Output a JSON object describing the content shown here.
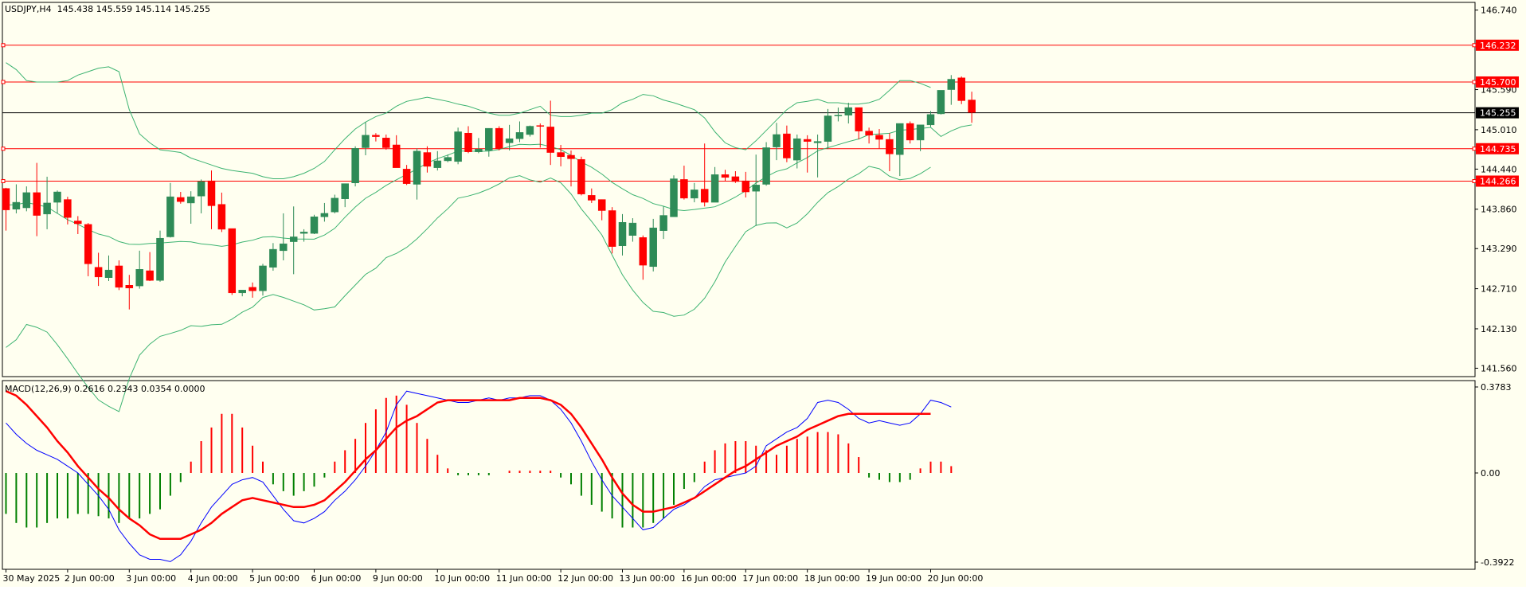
{
  "header": {
    "symbol_tf": "USDJPY,H4",
    "ohlc": "145.438 145.559 145.114 145.255"
  },
  "macd_header": "MACD(12,26,9) 0.2616 0.2343 0.0354 0.0000",
  "colors": {
    "background": "#fffff0",
    "bull_candle": "#2e8b57",
    "bear_candle": "#ff0000",
    "bands": "#3cb371",
    "level_line": "#ff0000",
    "price_line": "#000000",
    "macd_line": "#0000ff",
    "signal_line": "#ff0000",
    "hist_pos": "#ff0000",
    "hist_neg": "#008000"
  },
  "chart_data": [
    {
      "type": "candlestick",
      "instrument": "USDJPY",
      "timeframe": "H4",
      "y_ticks": [
        "146.740",
        "145.590",
        "145.010",
        "144.440",
        "143.860",
        "143.290",
        "142.710",
        "142.130",
        "141.560"
      ],
      "ylim": [
        141.45,
        146.84
      ],
      "x_labels": [
        "30 May 2025",
        "2 Jun 00:00",
        "3 Jun 00:00",
        "4 Jun 00:00",
        "5 Jun 00:00",
        "6 Jun 00:00",
        "9 Jun 00:00",
        "10 Jun 00:00",
        "11 Jun 00:00",
        "12 Jun 00:00",
        "13 Jun 00:00",
        "16 Jun 00:00",
        "17 Jun 00:00",
        "18 Jun 00:00",
        "19 Jun 00:00",
        "20 Jun 00:00"
      ],
      "x_label_bar_index": [
        0,
        6,
        12,
        18,
        24,
        30,
        36,
        42,
        48,
        54,
        60,
        66,
        72,
        78,
        84,
        90
      ],
      "horizontal_levels": [
        {
          "label": "146.232",
          "value": 146.232,
          "color": "#ff0000"
        },
        {
          "label": "145.700",
          "value": 145.7,
          "color": "#ff0000"
        },
        {
          "label": "145.255",
          "value": 145.255,
          "color": "#000000"
        },
        {
          "label": "144.735",
          "value": 144.735,
          "color": "#ff0000"
        },
        {
          "label": "144.266",
          "value": 144.266,
          "color": "#ff0000"
        }
      ],
      "candles": [
        [
          144.16,
          144.17,
          143.55,
          143.85
        ],
        [
          143.86,
          144.22,
          143.8,
          143.96
        ],
        [
          143.88,
          144.19,
          143.83,
          144.1
        ],
        [
          144.1,
          144.53,
          143.47,
          143.77
        ],
        [
          143.79,
          144.33,
          143.57,
          143.95
        ],
        [
          143.96,
          144.13,
          143.8,
          144.11
        ],
        [
          144.0,
          144.04,
          143.64,
          143.74
        ],
        [
          143.69,
          143.76,
          143.5,
          143.65
        ],
        [
          143.64,
          143.66,
          142.89,
          143.07
        ],
        [
          143.02,
          143.23,
          142.75,
          142.88
        ],
        [
          142.87,
          143.19,
          142.82,
          142.98
        ],
        [
          143.04,
          143.12,
          142.69,
          142.73
        ],
        [
          142.76,
          142.91,
          142.41,
          142.72
        ],
        [
          142.75,
          143.26,
          142.71,
          142.99
        ],
        [
          142.97,
          143.24,
          142.82,
          142.83
        ],
        [
          142.83,
          143.55,
          142.81,
          143.44
        ],
        [
          143.46,
          144.24,
          143.45,
          144.04
        ],
        [
          144.03,
          144.11,
          143.94,
          143.97
        ],
        [
          143.95,
          144.12,
          143.65,
          144.04
        ],
        [
          144.05,
          144.29,
          143.8,
          144.26
        ],
        [
          144.27,
          144.42,
          143.57,
          143.91
        ],
        [
          143.93,
          144.1,
          143.53,
          143.57
        ],
        [
          143.58,
          143.58,
          142.62,
          142.65
        ],
        [
          142.65,
          142.69,
          142.6,
          142.69
        ],
        [
          142.73,
          142.8,
          142.58,
          142.68
        ],
        [
          142.68,
          143.07,
          142.61,
          143.04
        ],
        [
          143.02,
          143.37,
          142.97,
          143.28
        ],
        [
          143.26,
          143.8,
          143.12,
          143.36
        ],
        [
          143.39,
          143.9,
          142.92,
          143.46
        ],
        [
          143.51,
          143.57,
          143.39,
          143.53
        ],
        [
          143.51,
          143.78,
          143.5,
          143.75
        ],
        [
          143.75,
          143.95,
          143.68,
          143.8
        ],
        [
          143.82,
          144.07,
          143.8,
          144.02
        ],
        [
          144.01,
          144.23,
          143.89,
          144.23
        ],
        [
          144.24,
          144.77,
          144.19,
          144.74
        ],
        [
          144.75,
          145.12,
          144.64,
          144.93
        ],
        [
          144.93,
          144.96,
          144.84,
          144.91
        ],
        [
          144.89,
          144.94,
          144.72,
          144.75
        ],
        [
          144.79,
          144.93,
          144.47,
          144.46
        ],
        [
          144.44,
          144.5,
          144.21,
          144.23
        ],
        [
          144.22,
          144.74,
          144.0,
          144.7
        ],
        [
          144.68,
          144.77,
          144.39,
          144.48
        ],
        [
          144.46,
          144.7,
          144.42,
          144.56
        ],
        [
          144.56,
          144.65,
          144.54,
          144.61
        ],
        [
          144.55,
          145.04,
          144.51,
          144.98
        ],
        [
          144.96,
          145.06,
          144.67,
          144.69
        ],
        [
          144.69,
          144.89,
          144.67,
          144.73
        ],
        [
          144.71,
          145.03,
          144.62,
          145.03
        ],
        [
          145.03,
          145.06,
          144.71,
          144.74
        ],
        [
          144.82,
          145.08,
          144.71,
          144.88
        ],
        [
          144.88,
          145.13,
          144.83,
          144.97
        ],
        [
          144.94,
          145.07,
          144.91,
          145.06
        ],
        [
          145.07,
          145.1,
          144.75,
          145.06
        ],
        [
          145.05,
          145.43,
          144.5,
          144.68
        ],
        [
          144.68,
          144.79,
          144.48,
          144.62
        ],
        [
          144.64,
          144.71,
          144.19,
          144.59
        ],
        [
          144.58,
          144.62,
          144.06,
          144.08
        ],
        [
          144.06,
          144.16,
          143.95,
          143.99
        ],
        [
          144.0,
          144.0,
          143.7,
          143.84
        ],
        [
          143.84,
          143.89,
          143.22,
          143.32
        ],
        [
          143.33,
          143.79,
          143.19,
          143.67
        ],
        [
          143.48,
          143.73,
          143.39,
          143.66
        ],
        [
          143.45,
          143.48,
          142.84,
          143.05
        ],
        [
          143.03,
          143.72,
          142.96,
          143.59
        ],
        [
          143.55,
          143.9,
          143.43,
          143.77
        ],
        [
          143.75,
          144.35,
          143.75,
          144.3
        ],
        [
          144.29,
          144.49,
          144.0,
          144.02
        ],
        [
          144.02,
          144.24,
          143.96,
          144.14
        ],
        [
          144.15,
          144.81,
          143.9,
          143.96
        ],
        [
          143.96,
          144.47,
          143.99,
          144.36
        ],
        [
          144.36,
          144.43,
          144.26,
          144.32
        ],
        [
          144.33,
          144.41,
          144.24,
          144.26
        ],
        [
          144.27,
          144.4,
          144.03,
          144.11
        ],
        [
          144.12,
          144.65,
          143.62,
          144.21
        ],
        [
          144.22,
          144.83,
          144.2,
          144.75
        ],
        [
          144.76,
          145.11,
          144.57,
          144.94
        ],
        [
          144.95,
          145.07,
          144.54,
          144.6
        ],
        [
          144.57,
          144.94,
          144.45,
          144.88
        ],
        [
          144.87,
          144.93,
          144.39,
          144.84
        ],
        [
          144.82,
          144.94,
          144.32,
          144.84
        ],
        [
          144.84,
          145.31,
          144.73,
          145.21
        ],
        [
          145.21,
          145.33,
          145.13,
          145.22
        ],
        [
          145.22,
          145.4,
          145.1,
          145.33
        ],
        [
          145.33,
          145.33,
          144.87,
          144.99
        ],
        [
          144.99,
          145.04,
          144.81,
          144.93
        ],
        [
          144.93,
          145.02,
          144.74,
          144.87
        ],
        [
          144.87,
          144.96,
          144.41,
          144.66
        ],
        [
          144.65,
          145.1,
          144.34,
          145.1
        ],
        [
          145.1,
          145.13,
          144.81,
          144.86
        ],
        [
          144.86,
          145.0,
          144.7,
          145.08
        ],
        [
          145.08,
          145.28,
          145.05,
          145.23
        ],
        [
          145.24,
          145.53,
          145.23,
          145.58
        ],
        [
          145.59,
          145.8,
          145.37,
          145.74
        ],
        [
          145.76,
          145.78,
          145.38,
          145.43
        ],
        [
          145.44,
          145.56,
          145.11,
          145.26
        ]
      ],
      "bollinger": {
        "upper": [
          145.98,
          145.88,
          145.72,
          145.7,
          145.7,
          145.7,
          145.72,
          145.8,
          145.85,
          145.9,
          145.92,
          145.85,
          145.3,
          144.95,
          144.82,
          144.72,
          144.7,
          144.68,
          144.6,
          144.55,
          144.5,
          144.45,
          144.42,
          144.4,
          144.38,
          144.33,
          144.3,
          144.3,
          144.33,
          144.38,
          144.45,
          144.55,
          144.72,
          144.88,
          145.02,
          145.12,
          145.2,
          145.25,
          145.35,
          145.42,
          145.45,
          145.48,
          145.45,
          145.42,
          145.38,
          145.35,
          145.3,
          145.25,
          145.22,
          145.22,
          145.25,
          145.3,
          145.35,
          145.22,
          145.2,
          145.2,
          145.22,
          145.25,
          145.25,
          145.3,
          145.4,
          145.45,
          145.52,
          145.5,
          145.44,
          145.4,
          145.35,
          145.3,
          145.18,
          144.98,
          144.82,
          144.75,
          144.72,
          144.85,
          145.0,
          145.15,
          145.3,
          145.4,
          145.42,
          145.45,
          145.4,
          145.4,
          145.38,
          145.38,
          145.4,
          145.45,
          145.58,
          145.72,
          145.72,
          145.68,
          145.62
        ]
      },
      "macd": {
        "ylim": [
          -0.3922,
          0.3783
        ],
        "y_ticks": [
          "0.3783",
          "0.00",
          "-0.3922"
        ],
        "macd": [
          0.22,
          0.17,
          0.13,
          0.1,
          0.08,
          0.06,
          0.03,
          0.0,
          -0.05,
          -0.1,
          -0.16,
          -0.25,
          -0.31,
          -0.36,
          -0.38,
          -0.38,
          -0.39,
          -0.36,
          -0.3,
          -0.22,
          -0.15,
          -0.1,
          -0.05,
          -0.03,
          -0.02,
          -0.04,
          -0.1,
          -0.16,
          -0.21,
          -0.22,
          -0.2,
          -0.17,
          -0.12,
          -0.08,
          -0.03,
          0.03,
          0.1,
          0.18,
          0.3,
          0.36,
          0.35,
          0.34,
          0.33,
          0.32,
          0.31,
          0.31,
          0.32,
          0.33,
          0.32,
          0.33,
          0.33,
          0.34,
          0.34,
          0.32,
          0.28,
          0.22,
          0.14,
          0.05,
          -0.03,
          -0.1,
          -0.15,
          -0.2,
          -0.25,
          -0.24,
          -0.2,
          -0.16,
          -0.14,
          -0.11,
          -0.06,
          -0.03,
          -0.02,
          -0.01,
          0.0,
          0.03,
          0.12,
          0.15,
          0.18,
          0.2,
          0.24,
          0.31,
          0.32,
          0.31,
          0.28,
          0.24,
          0.22,
          0.23,
          0.22,
          0.21,
          0.22,
          0.26,
          0.32,
          0.31,
          0.29
        ]
      },
      "signal_line": {
        "values": [
          0.36,
          0.34,
          0.3,
          0.25,
          0.2,
          0.14,
          0.09,
          0.03,
          -0.02,
          -0.07,
          -0.11,
          -0.16,
          -0.2,
          -0.23,
          -0.27,
          -0.29,
          -0.29,
          -0.29,
          -0.27,
          -0.25,
          -0.22,
          -0.18,
          -0.15,
          -0.12,
          -0.11,
          -0.12,
          -0.13,
          -0.14,
          -0.15,
          -0.15,
          -0.14,
          -0.12,
          -0.08,
          -0.04,
          0.01,
          0.06,
          0.1,
          0.15,
          0.2,
          0.23,
          0.25,
          0.28,
          0.31,
          0.32,
          0.32,
          0.32,
          0.32,
          0.32,
          0.32,
          0.32,
          0.33,
          0.33,
          0.33,
          0.32,
          0.3,
          0.26,
          0.2,
          0.13,
          0.06,
          -0.02,
          -0.09,
          -0.14,
          -0.17,
          -0.17,
          -0.16,
          -0.15,
          -0.13,
          -0.11,
          -0.08,
          -0.05,
          -0.02,
          0.01,
          0.03,
          0.06,
          0.09,
          0.12,
          0.14,
          0.16,
          0.19,
          0.21,
          0.23,
          0.25,
          0.26,
          0.26,
          0.26,
          0.26,
          0.26,
          0.26,
          0.26,
          0.26,
          0.26
        ]
      },
      "histogram": {
        "values": [
          -0.18,
          -0.22,
          -0.24,
          -0.24,
          -0.22,
          -0.2,
          -0.2,
          -0.18,
          -0.18,
          -0.19,
          -0.2,
          -0.22,
          -0.2,
          -0.2,
          -0.18,
          -0.16,
          -0.1,
          -0.04,
          0.05,
          0.14,
          0.2,
          0.26,
          0.26,
          0.2,
          0.12,
          0.05,
          -0.05,
          -0.08,
          -0.1,
          -0.08,
          -0.06,
          -0.02,
          0.05,
          0.1,
          0.15,
          0.22,
          0.28,
          0.33,
          0.34,
          0.3,
          0.22,
          0.15,
          0.08,
          0.02,
          -0.01,
          -0.01,
          -0.01,
          -0.01,
          0.0,
          0.01,
          0.01,
          0.01,
          0.01,
          0.01,
          -0.02,
          -0.05,
          -0.1,
          -0.14,
          -0.17,
          -0.2,
          -0.24,
          -0.24,
          -0.24,
          -0.22,
          -0.2,
          -0.14,
          -0.07,
          -0.04,
          0.05,
          0.1,
          0.13,
          0.14,
          0.14,
          0.12,
          0.1,
          0.08,
          0.12,
          0.15,
          0.16,
          0.18,
          0.18,
          0.17,
          0.13,
          0.07,
          -0.02,
          -0.03,
          -0.04,
          -0.04,
          -0.03,
          0.02,
          0.05,
          0.05,
          0.03
        ]
      }
    }
  ]
}
